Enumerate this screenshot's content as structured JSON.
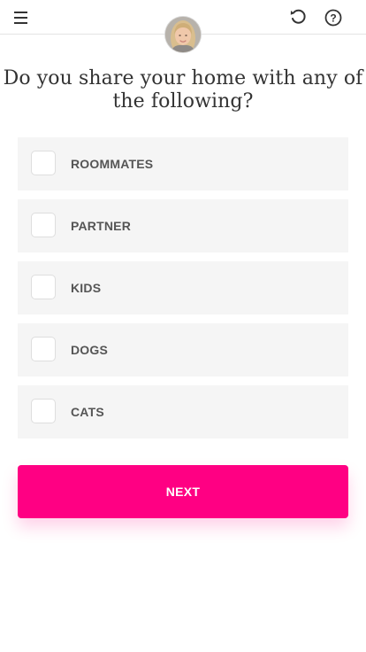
{
  "header": {
    "menu_icon": "hamburger-menu-icon",
    "undo_icon": "undo-icon",
    "help_icon": "question-mark-icon",
    "avatar": "user-avatar"
  },
  "question": "Do you share your home with any of the following?",
  "options": [
    {
      "label": "ROOMMATES",
      "checked": false
    },
    {
      "label": "PARTNER",
      "checked": false
    },
    {
      "label": "KIDS",
      "checked": false
    },
    {
      "label": "DOGS",
      "checked": false
    },
    {
      "label": "CATS",
      "checked": false
    }
  ],
  "next_button": {
    "label": "NEXT"
  },
  "colors": {
    "accent": "#ff0083",
    "option_background": "#f5f5f5",
    "text": "#333333"
  }
}
